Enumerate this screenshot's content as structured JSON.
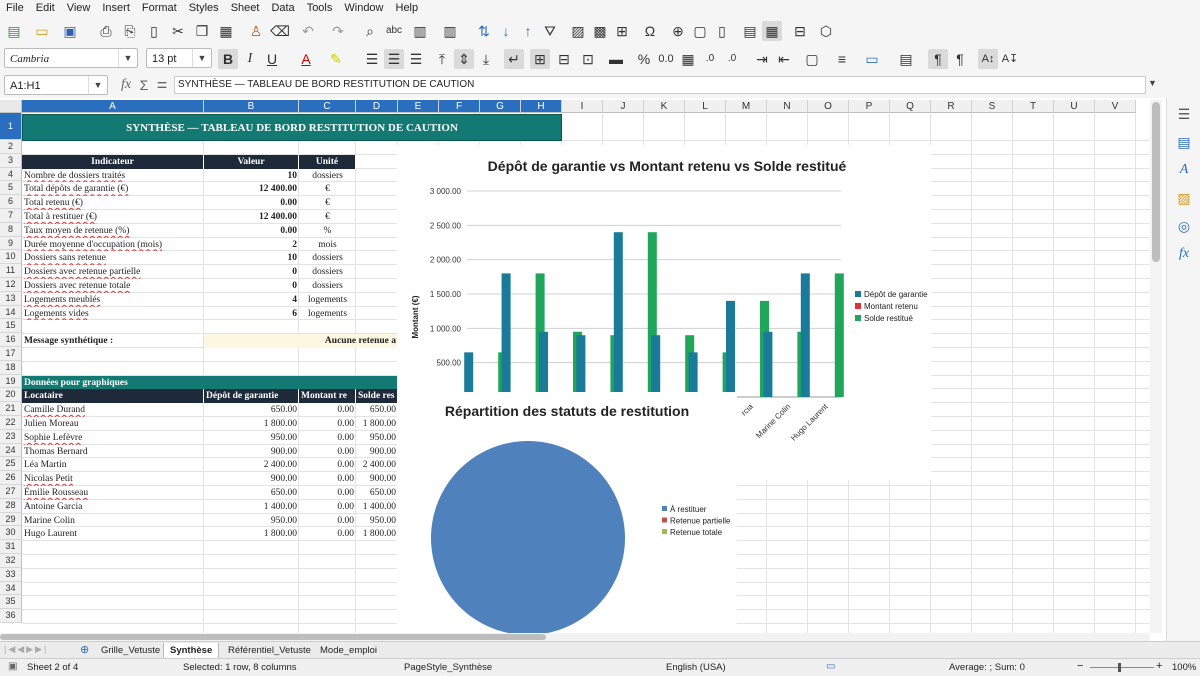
{
  "menu": [
    "File",
    "Edit",
    "View",
    "Insert",
    "Format",
    "Styles",
    "Sheet",
    "Data",
    "Tools",
    "Window",
    "Help"
  ],
  "font_name": "Cambria",
  "font_size": "13 pt",
  "name_box": "A1:H1",
  "formula": "SYNTHÈSE — TABLEAU DE BORD RESTITUTION DE CAUTION",
  "columns": [
    "A",
    "B",
    "C",
    "D",
    "E",
    "F",
    "G",
    "H",
    "I",
    "J",
    "K",
    "L",
    "M",
    "N",
    "O",
    "P",
    "Q",
    "R",
    "S",
    "T",
    "U",
    "V"
  ],
  "rows": [
    "1",
    "2",
    "3",
    "4",
    "5",
    "6",
    "7",
    "8",
    "9",
    "10",
    "11",
    "12",
    "13",
    "14",
    "15",
    "16",
    "17",
    "18",
    "19",
    "20",
    "21",
    "22",
    "23",
    "24",
    "25",
    "26",
    "27",
    "28",
    "29",
    "30",
    "31",
    "32",
    "33",
    "34",
    "35",
    "36"
  ],
  "title_cell": "SYNTHÈSE — TABLEAU DE BORD RESTITUTION DE CAUTION",
  "summary": {
    "headers": [
      "Indicateur",
      "Valeur",
      "Unité"
    ],
    "rows": [
      {
        "label": "Nombre de dossiers traités",
        "value": "10",
        "unit": "dossiers"
      },
      {
        "label": "Total dépôts de garantie (€)",
        "value": "12 400.00",
        "unit": "€"
      },
      {
        "label": "Total retenu (€)",
        "value": "0.00",
        "unit": "€"
      },
      {
        "label": "Total à restituer (€)",
        "value": "12 400.00",
        "unit": "€"
      },
      {
        "label": "Taux moyen de retenue (%)",
        "value": "0.00",
        "unit": "%"
      },
      {
        "label": "Durée moyenne d'occupation (mois)",
        "value": "2",
        "unit": "mois"
      },
      {
        "label": "Dossiers sans retenue",
        "value": "10",
        "unit": "dossiers"
      },
      {
        "label": "Dossiers avec retenue partielle",
        "value": "0",
        "unit": "dossiers"
      },
      {
        "label": "Dossiers avec retenue totale",
        "value": "0",
        "unit": "dossiers"
      },
      {
        "label": "Logements meublés",
        "value": "4",
        "unit": "logements"
      },
      {
        "label": "Logements vides",
        "value": "6",
        "unit": "logements"
      }
    ]
  },
  "message_label": "Message synthétique :",
  "message_value": "Aucune retenue a",
  "graph_section_title": "Données pour graphiques",
  "graph_table": {
    "headers": [
      "Locataire",
      "Dépôt de garantie",
      "Montant re",
      "Solde res"
    ],
    "rows": [
      [
        "Camille Durand",
        "650.00",
        "0.00",
        "650.00"
      ],
      [
        "Julien Moreau",
        "1 800.00",
        "0.00",
        "1 800.00"
      ],
      [
        "Sophie Lefèvre",
        "950.00",
        "0.00",
        "950.00"
      ],
      [
        "Thomas Bernard",
        "900.00",
        "0.00",
        "900.00"
      ],
      [
        "Léa Martin",
        "2 400.00",
        "0.00",
        "2 400.00"
      ],
      [
        "Nicolas Petit",
        "900.00",
        "0.00",
        "900.00"
      ],
      [
        "Émilie Rousseau",
        "650.00",
        "0.00",
        "650.00"
      ],
      [
        "Antoine Garcia",
        "1 400.00",
        "0.00",
        "1 400.00"
      ],
      [
        "Marine Colin",
        "950.00",
        "0.00",
        "950.00"
      ],
      [
        "Hugo Laurent",
        "1 800.00",
        "0.00",
        "1 800.00"
      ]
    ]
  },
  "chart_data": [
    {
      "type": "bar",
      "title": "Dépôt de garantie vs Montant retenu vs Solde restitué",
      "ylabel": "Montant (€)",
      "ylim": [
        0,
        3000
      ],
      "yticks": [
        "500.00",
        "1 000.00",
        "1 500.00",
        "2 000.00",
        "2 500.00",
        "3 000.00"
      ],
      "categories": [
        "Camille Durand",
        "Julien Moreau",
        "Sophie Lefèvre",
        "Thomas Bernard",
        "Léa Martin",
        "Nicolas Petit",
        "Émilie Rousseau",
        "Antoine Garcia",
        "Marine Colin",
        "Hugo Laurent"
      ],
      "visible_xlabels": [
        "rcia",
        "Marine Colin",
        "Hugo Laurent"
      ],
      "series": [
        {
          "name": "Dépôt de garantie",
          "color": "#1a7a99",
          "values": [
            650,
            1800,
            950,
            900,
            2400,
            900,
            650,
            1400,
            950,
            1800
          ]
        },
        {
          "name": "Montant retenu",
          "color": "#e0313b",
          "values": [
            0,
            0,
            0,
            0,
            0,
            0,
            0,
            0,
            0,
            0
          ]
        },
        {
          "name": "Solde restitué",
          "color": "#1fa65a",
          "values": [
            650,
            1800,
            950,
            900,
            2400,
            900,
            650,
            1400,
            950,
            1800
          ]
        }
      ],
      "legend": "right"
    },
    {
      "type": "pie",
      "title": "Répartition des statuts de restitution",
      "categories": [
        "À restituer",
        "Retenue partielle",
        "Retenue totale"
      ],
      "values": [
        10,
        0,
        0
      ],
      "colors": [
        "#4f81bd",
        "#c0504d",
        "#9bbb59"
      ],
      "legend": "right"
    }
  ],
  "sheet_tabs": [
    "Grille_Vetuste",
    "Synthèse",
    "Référentiel_Vetuste",
    "Mode_emploi"
  ],
  "active_tab": "Synthèse",
  "status": {
    "sheet": "Sheet 2 of 4",
    "selection": "Selected: 1 row, 8 columns",
    "page_style": "PageStyle_Synthèse",
    "language": "English (USA)",
    "sum": "Average: ; Sum: 0",
    "zoom": "100%"
  },
  "colors": {
    "title_bg": "#127a72",
    "header_bg": "#1e2a3a",
    "section_bg": "#127a72",
    "selection": "#2a6fbf"
  }
}
